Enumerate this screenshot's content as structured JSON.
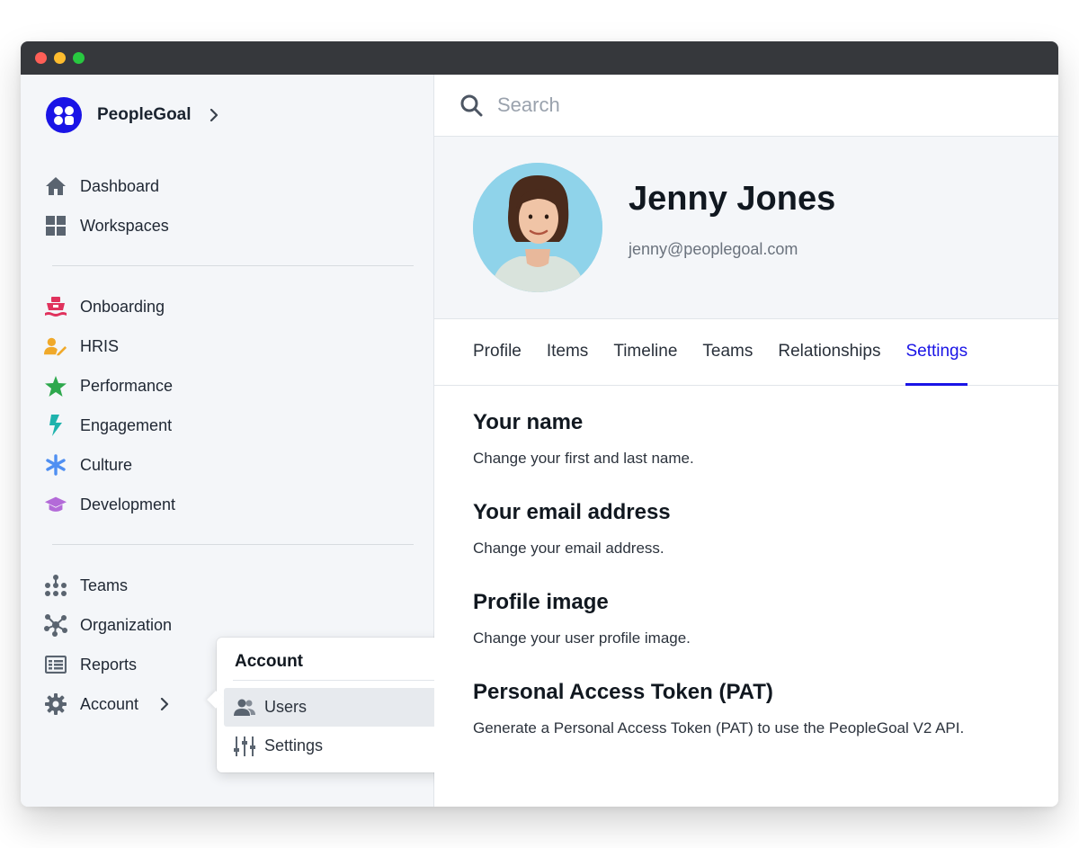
{
  "window": {
    "controls": [
      "close",
      "minimize",
      "maximize"
    ]
  },
  "brand": {
    "name": "PeopleGoal",
    "color": "#1a14e6"
  },
  "sidebar": {
    "group1": [
      {
        "label": "Dashboard",
        "icon": "home-icon"
      },
      {
        "label": "Workspaces",
        "icon": "grid-icon"
      }
    ],
    "group2": [
      {
        "label": "Onboarding",
        "icon": "ship-icon",
        "color": "#e0325d"
      },
      {
        "label": "HRIS",
        "icon": "user-edit-icon",
        "color": "#f0a92a"
      },
      {
        "label": "Performance",
        "icon": "star-icon",
        "color": "#2ea84d"
      },
      {
        "label": "Engagement",
        "icon": "bolt-icon",
        "color": "#1fb3ad"
      },
      {
        "label": "Culture",
        "icon": "asterisk-icon",
        "color": "#4f8ff2"
      },
      {
        "label": "Development",
        "icon": "graduation-cap-icon",
        "color": "#b36ad8"
      }
    ],
    "group3": [
      {
        "label": "Teams",
        "icon": "hierarchy-icon"
      },
      {
        "label": "Organization",
        "icon": "network-icon"
      },
      {
        "label": "Reports",
        "icon": "report-icon"
      },
      {
        "label": "Account",
        "icon": "gear-icon"
      }
    ]
  },
  "search": {
    "placeholder": "Search"
  },
  "profile": {
    "name": "Jenny Jones",
    "email": "jenny@peoplegoal.com"
  },
  "tabs": [
    {
      "label": "Profile",
      "active": false
    },
    {
      "label": "Items",
      "active": false
    },
    {
      "label": "Timeline",
      "active": false
    },
    {
      "label": "Teams",
      "active": false
    },
    {
      "label": "Relationships",
      "active": false
    },
    {
      "label": "Settings",
      "active": true
    }
  ],
  "settings": [
    {
      "title": "Your name",
      "desc": "Change your first and last name."
    },
    {
      "title": "Your email address",
      "desc": "Change your email address."
    },
    {
      "title": "Profile image",
      "desc": "Change your user profile image."
    },
    {
      "title": "Personal Access Token (PAT)",
      "desc": "Generate a Personal Access Token (PAT) to use the PeopleGoal V2 API."
    }
  ],
  "popover": {
    "title": "Account",
    "items": [
      {
        "label": "Users",
        "icon": "users-icon"
      },
      {
        "label": "Settings",
        "icon": "sliders-icon"
      }
    ]
  },
  "colors": {
    "accent": "#1a14e6",
    "sidebar_bg": "#f4f6f9",
    "icon_gray": "#5a6470"
  }
}
